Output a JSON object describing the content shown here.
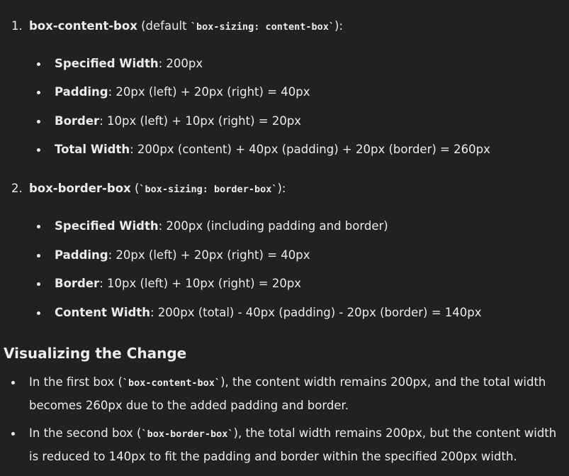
{
  "steps": [
    {
      "number": "1.",
      "title": "box-content-box",
      "pre": " (default ",
      "code": "`box-sizing: content-box`",
      "post": "):",
      "items": [
        {
          "label": "Specified Width",
          "text": ": 200px"
        },
        {
          "label": "Padding",
          "text": ": 20px (left) + 20px (right) = 40px"
        },
        {
          "label": "Border",
          "text": ": 10px (left) + 10px (right) = 20px"
        },
        {
          "label": "Total Width",
          "text": ": 200px (content) + 40px (padding) + 20px (border) = 260px"
        }
      ]
    },
    {
      "number": "2.",
      "title": "box-border-box",
      "pre": " (",
      "code": "`box-sizing: border-box`",
      "post": "):",
      "items": [
        {
          "label": "Specified Width",
          "text": ": 200px (including padding and border)"
        },
        {
          "label": "Padding",
          "text": ": 20px (left) + 20px (right) = 40px"
        },
        {
          "label": "Border",
          "text": ": 10px (left) + 10px (right) = 20px"
        },
        {
          "label": "Content Width",
          "text": ": 200px (total) - 40px (padding) - 20px (border) = 140px"
        }
      ]
    }
  ],
  "section_heading": "Visualizing the Change",
  "notes": [
    {
      "pre": "In the first box (",
      "code": "`box-content-box`",
      "post": "), the content width remains 200px, and the total width becomes 260px due to the added padding and border."
    },
    {
      "pre": "In the second box (",
      "code": "`box-border-box`",
      "post": "), the total width remains 200px, but the content width is reduced to 140px to fit the padding and border within the specified 200px width."
    }
  ]
}
